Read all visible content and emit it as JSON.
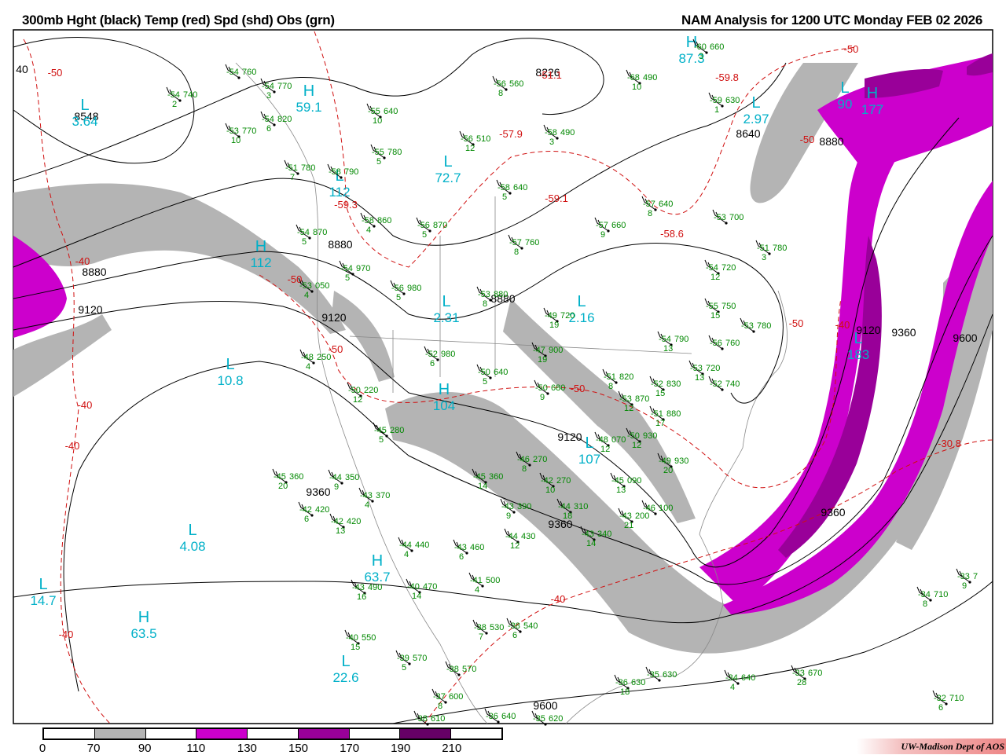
{
  "header": {
    "left_title": "300mb Hght (black) Temp (red) Spd (shd) Obs (grn)",
    "right_title": "NAM Analysis for 1200 UTC Monday  FEB 02 2026"
  },
  "colors": {
    "height": "#000000",
    "temp": "#d01010",
    "obs": "#008800",
    "center": "#00b0c8",
    "spd_70_90": "#b4b4b4",
    "spd_110_130": "#cc00cc",
    "spd_150_170": "#990099",
    "spd_190_210": "#660066"
  },
  "colorbar": {
    "labels": [
      "0",
      "70",
      "90",
      "110",
      "130",
      "150",
      "170",
      "190",
      "210"
    ],
    "fills": [
      "#ffffff",
      "#b4b4b4",
      "#ffffff",
      "#cc00cc",
      "#ffffff",
      "#990099",
      "#ffffff",
      "#660066",
      "#ffffff"
    ]
  },
  "credit": "UW-Madison   Dept of AOS",
  "height_labels": [
    "8548",
    "8226",
    "8640",
    "8880",
    "8880",
    "8880",
    "8880",
    "9120",
    "9120",
    "9120",
    "9120",
    "9360",
    "9360",
    "9360",
    "9360",
    "9600",
    "9600",
    "40"
  ],
  "temp_labels": [
    "-50",
    "-40",
    "-40",
    "-40",
    "-40",
    "-50",
    "-50",
    "-59.3",
    "-59.8",
    "-58.6",
    "-59.1",
    "-50",
    "-50",
    "-50",
    "-50",
    "-40",
    "-40",
    "-30.8",
    "-57.9",
    "-51.1"
  ],
  "centers": [
    {
      "type": "L",
      "value": "3.64"
    },
    {
      "type": "H",
      "value": "59.1"
    },
    {
      "type": "L",
      "value": "112"
    },
    {
      "type": "H",
      "value": "112"
    },
    {
      "type": "L",
      "value": "72.7"
    },
    {
      "type": "L",
      "value": "2.31"
    },
    {
      "type": "L",
      "value": "2.16"
    },
    {
      "type": "H",
      "value": "104"
    },
    {
      "type": "L",
      "value": "10.8"
    },
    {
      "type": "L",
      "value": "4.08"
    },
    {
      "type": "L",
      "value": "14.7"
    },
    {
      "type": "H",
      "value": "63.5"
    },
    {
      "type": "H",
      "value": "63.7"
    },
    {
      "type": "L",
      "value": "22.6"
    },
    {
      "type": "L",
      "value": "2.97"
    },
    {
      "type": "H",
      "value": "177"
    },
    {
      "type": "L",
      "value": "183"
    },
    {
      "type": "H",
      "value": "87.3"
    },
    {
      "type": "L",
      "value": "107"
    },
    {
      "type": "L",
      "value": "90"
    }
  ],
  "stations": [
    {
      "t": "-54",
      "z": "760",
      "d": ""
    },
    {
      "t": "-54",
      "z": "770",
      "d": "3"
    },
    {
      "t": "-54",
      "z": "740",
      "d": "2"
    },
    {
      "t": "-54",
      "z": "820",
      "d": "6"
    },
    {
      "t": "-53",
      "z": "770",
      "d": "10"
    },
    {
      "t": "-51",
      "z": "780",
      "d": "7"
    },
    {
      "t": "-58",
      "z": "790",
      "d": ""
    },
    {
      "t": "-54",
      "z": "870",
      "d": "5"
    },
    {
      "t": "-58",
      "z": "860",
      "d": "4"
    },
    {
      "t": "-56",
      "z": "870",
      "d": "5"
    },
    {
      "t": "-54",
      "z": "970",
      "d": "5"
    },
    {
      "t": "-53",
      "z": "050",
      "d": "4"
    },
    {
      "t": "-56",
      "z": "980",
      "d": "5"
    },
    {
      "t": "-48",
      "z": "250",
      "d": "4"
    },
    {
      "t": "-52",
      "z": "980",
      "d": "6"
    },
    {
      "t": "-50",
      "z": "220",
      "d": "12"
    },
    {
      "t": "-45",
      "z": "280",
      "d": "5"
    },
    {
      "t": "-45",
      "z": "360",
      "d": "20"
    },
    {
      "t": "-44",
      "z": "350",
      "d": "9"
    },
    {
      "t": "-43",
      "z": "370",
      "d": "4"
    },
    {
      "t": "-42",
      "z": "420",
      "d": "6"
    },
    {
      "t": "-42",
      "z": "420",
      "d": "13"
    },
    {
      "t": "-44",
      "z": "440",
      "d": "4"
    },
    {
      "t": "-43",
      "z": "460",
      "d": "6"
    },
    {
      "t": "-43",
      "z": "490",
      "d": "16"
    },
    {
      "t": "-40",
      "z": "470",
      "d": "14"
    },
    {
      "t": "-41",
      "z": "500",
      "d": "4"
    },
    {
      "t": "-40",
      "z": "550",
      "d": "15"
    },
    {
      "t": "-38",
      "z": "530",
      "d": "7"
    },
    {
      "t": "-38",
      "z": "540",
      "d": "6"
    },
    {
      "t": "-39",
      "z": "570",
      "d": "5"
    },
    {
      "t": "-38",
      "z": "570",
      "d": ""
    },
    {
      "t": "-37",
      "z": "600",
      "d": "8"
    },
    {
      "t": "-38",
      "z": "610",
      "d": ""
    },
    {
      "t": "-36",
      "z": "640",
      "d": ""
    },
    {
      "t": "-35",
      "z": "620",
      "d": ""
    },
    {
      "t": "-36",
      "z": "630",
      "d": "18"
    },
    {
      "t": "-35",
      "z": "630",
      "d": ""
    },
    {
      "t": "-34",
      "z": "640",
      "d": "4"
    },
    {
      "t": "-33",
      "z": "670",
      "d": "28"
    },
    {
      "t": "-32",
      "z": "710",
      "d": "6"
    },
    {
      "t": "-34",
      "z": "710",
      "d": "8"
    },
    {
      "t": "-33",
      "z": "7",
      "d": "9"
    },
    {
      "t": "-45",
      "z": "360",
      "d": "14"
    },
    {
      "t": "-43",
      "z": "390",
      "d": "9"
    },
    {
      "t": "-46",
      "z": "270",
      "d": "8"
    },
    {
      "t": "-42",
      "z": "270",
      "d": "10"
    },
    {
      "t": "-44",
      "z": "310",
      "d": "18"
    },
    {
      "t": "-44",
      "z": "430",
      "d": "12"
    },
    {
      "t": "-43",
      "z": "340",
      "d": "14"
    },
    {
      "t": "-43",
      "z": "200",
      "d": "21"
    },
    {
      "t": "-46",
      "z": "100",
      "d": ""
    },
    {
      "t": "-45",
      "z": "090",
      "d": "13"
    },
    {
      "t": "-48",
      "z": "070",
      "d": "12"
    },
    {
      "t": "-50",
      "z": "930",
      "d": "12"
    },
    {
      "t": "-49",
      "z": "930",
      "d": "20"
    },
    {
      "t": "-55",
      "z": "640",
      "d": "10"
    },
    {
      "t": "-55",
      "z": "780",
      "d": "5"
    },
    {
      "t": "-56",
      "z": "510",
      "d": "12"
    },
    {
      "t": "-58",
      "z": "490",
      "d": "3"
    },
    {
      "t": "-56",
      "z": "560",
      "d": "8"
    },
    {
      "t": "-68",
      "z": "490",
      "d": "10"
    },
    {
      "t": "-60",
      "z": "660",
      "d": "3"
    },
    {
      "t": "-59",
      "z": "630",
      "d": "1"
    },
    {
      "t": "-58",
      "z": "640",
      "d": "5"
    },
    {
      "t": "-57",
      "z": "640",
      "d": "8"
    },
    {
      "t": "-57",
      "z": "660",
      "d": "9"
    },
    {
      "t": "-53",
      "z": "700",
      "d": ""
    },
    {
      "t": "-51",
      "z": "780",
      "d": "3"
    },
    {
      "t": "-54",
      "z": "720",
      "d": "12"
    },
    {
      "t": "-55",
      "z": "750",
      "d": "15"
    },
    {
      "t": "-53",
      "z": "780",
      "d": ""
    },
    {
      "t": "-56",
      "z": "760",
      "d": ""
    },
    {
      "t": "-54",
      "z": "790",
      "d": "13"
    },
    {
      "t": "-53",
      "z": "720",
      "d": "13"
    },
    {
      "t": "-52",
      "z": "740",
      "d": ""
    },
    {
      "t": "-51",
      "z": "820",
      "d": "8"
    },
    {
      "t": "-52",
      "z": "830",
      "d": "15"
    },
    {
      "t": "-53",
      "z": "870",
      "d": "12"
    },
    {
      "t": "-51",
      "z": "880",
      "d": "17"
    },
    {
      "t": "-50",
      "z": "640",
      "d": "5"
    },
    {
      "t": "-50",
      "z": "680",
      "d": "9"
    },
    {
      "t": "-49",
      "z": "720",
      "d": "19"
    },
    {
      "t": "-53",
      "z": "880",
      "d": "8"
    },
    {
      "t": "-57",
      "z": "760",
      "d": "8"
    },
    {
      "t": "-47",
      "z": "900",
      "d": "19"
    }
  ]
}
